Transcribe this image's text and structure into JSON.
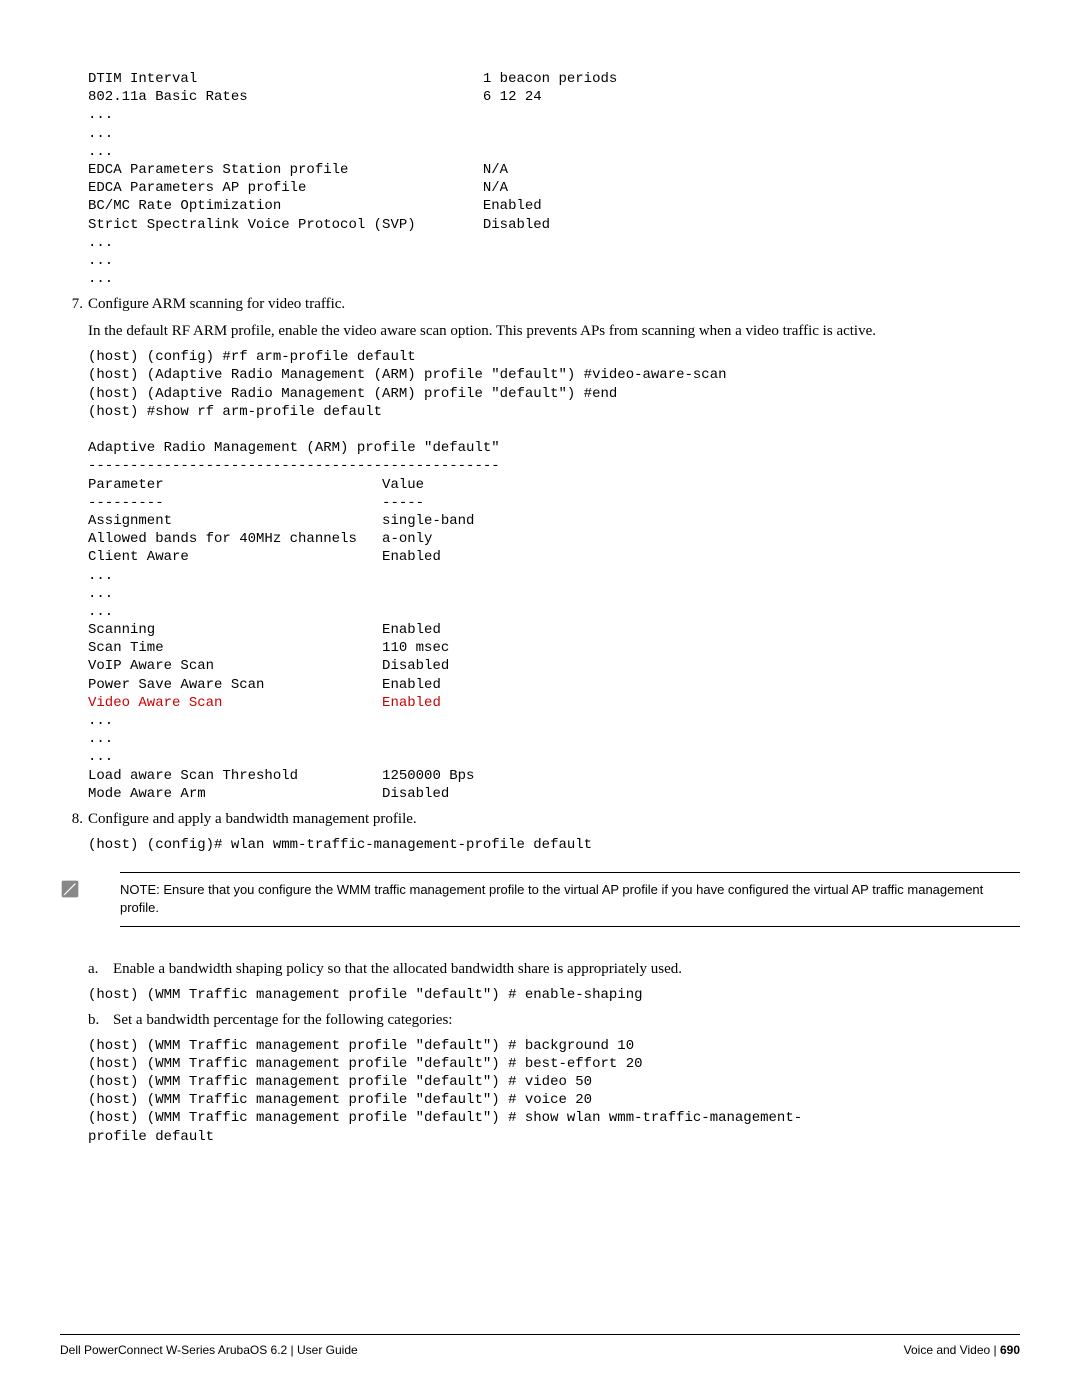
{
  "block1": "DTIM Interval                                  1 beacon periods\n802.11a Basic Rates                            6 12 24\n...\n...\n...\nEDCA Parameters Station profile                N/A\nEDCA Parameters AP profile                     N/A\nBC/MC Rate Optimization                        Enabled\nStrict Spectralink Voice Protocol (SVP)        Disabled\n...\n...\n...",
  "step7_num": "7.",
  "step7_title": "Configure ARM scanning for video traffic.",
  "step7_para": "In the default RF ARM profile, enable the video aware scan option. This prevents APs from scanning when a video traffic is active.",
  "block2_pre": "(host) (config) #rf arm-profile default\n(host) (Adaptive Radio Management (ARM) profile \"default\") #video-aware-scan\n(host) (Adaptive Radio Management (ARM) profile \"default\") #end\n(host) #show rf arm-profile default\n\nAdaptive Radio Management (ARM) profile \"default\"\n-------------------------------------------------\nParameter                          Value\n---------                          -----\nAssignment                         single-band\nAllowed bands for 40MHz channels   a-only\nClient Aware                       Enabled\n...\n...\n...\nScanning                           Enabled\nScan Time                          110 msec\nVoIP Aware Scan                    Disabled\nPower Save Aware Scan              Enabled",
  "block2_red": "Video Aware Scan                   Enabled",
  "block2_post": "...\n...\n...\nLoad aware Scan Threshold          1250000 Bps\nMode Aware Arm                     Disabled",
  "step8_num": "8.",
  "step8_title": "Configure and apply a bandwidth management profile.",
  "block3": "(host) (config)# wlan wmm-traffic-management-profile default",
  "note_label": "NOTE:",
  "note_text": " Ensure that you configure the WMM traffic management profile to the virtual AP profile if you have configured the virtual AP traffic management profile.",
  "sub_a_letter": "a.",
  "sub_a_text": "Enable a bandwidth shaping policy so that the allocated bandwidth share is appropriately used.",
  "block4": "(host) (WMM Traffic management profile \"default\") # enable-shaping",
  "sub_b_letter": "b.",
  "sub_b_text": "Set a bandwidth percentage for the following categories:",
  "block5": "(host) (WMM Traffic management profile \"default\") # background 10\n(host) (WMM Traffic management profile \"default\") # best-effort 20\n(host) (WMM Traffic management profile \"default\") # video 50\n(host) (WMM Traffic management profile \"default\") # voice 20\n(host) (WMM Traffic management profile \"default\") # show wlan wmm-traffic-management-\nprofile default",
  "footer_left": "Dell PowerConnect W-Series ArubaOS 6.2",
  "footer_left_suffix": "  |  User Guide",
  "footer_right_label": "Voice and Video",
  "footer_right_sep": "  |  ",
  "footer_right_page": "690"
}
